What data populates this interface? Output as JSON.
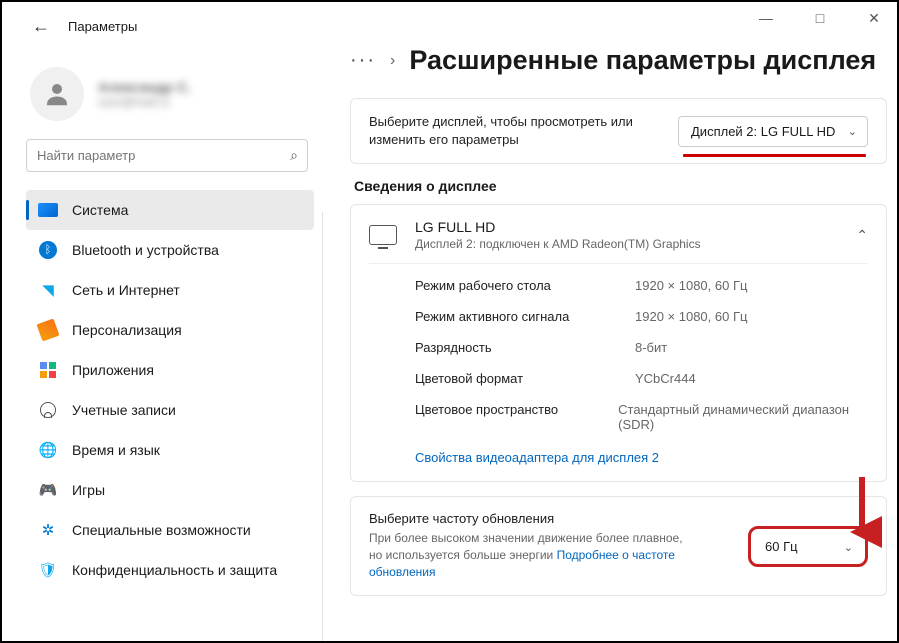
{
  "window": {
    "title": "Параметры",
    "minimize": "—",
    "maximize": "□",
    "close": "✕"
  },
  "user": {
    "name": "Александр С.",
    "email": "user@mail.ru"
  },
  "search": {
    "placeholder": "Найти параметр"
  },
  "nav": {
    "items": [
      {
        "label": "Система"
      },
      {
        "label": "Bluetooth и устройства"
      },
      {
        "label": "Сеть и Интернет"
      },
      {
        "label": "Персонализация"
      },
      {
        "label": "Приложения"
      },
      {
        "label": "Учетные записи"
      },
      {
        "label": "Время и язык"
      },
      {
        "label": "Игры"
      },
      {
        "label": "Специальные возможности"
      },
      {
        "label": "Конфиденциальность и защита"
      }
    ]
  },
  "breadcrumb": {
    "dots": "···",
    "title": "Расширенные параметры дисплея"
  },
  "display_select": {
    "hint": "Выберите дисплей, чтобы просмотреть или изменить его параметры",
    "value": "Дисплей 2: LG FULL HD"
  },
  "info": {
    "section": "Сведения о дисплее",
    "name": "LG FULL HD",
    "sub": "Дисплей 2: подключен к AMD Radeon(TM) Graphics",
    "rows": [
      {
        "k": "Режим рабочего стола",
        "v": "1920 × 1080, 60 Гц"
      },
      {
        "k": "Режим активного сигнала",
        "v": "1920 × 1080, 60 Гц"
      },
      {
        "k": "Разрядность",
        "v": "8-бит"
      },
      {
        "k": "Цветовой формат",
        "v": "YCbCr444"
      },
      {
        "k": "Цветовое пространство",
        "v": "Стандартный динамический диапазон (SDR)"
      }
    ],
    "adapter_link": "Свойства видеоадаптера для дисплея 2"
  },
  "refresh": {
    "title": "Выберите частоту обновления",
    "desc": "При более высоком значении движение более плавное, но используется больше энергии  ",
    "link": "Подробнее о частоте обновления",
    "value": "60 Гц"
  }
}
